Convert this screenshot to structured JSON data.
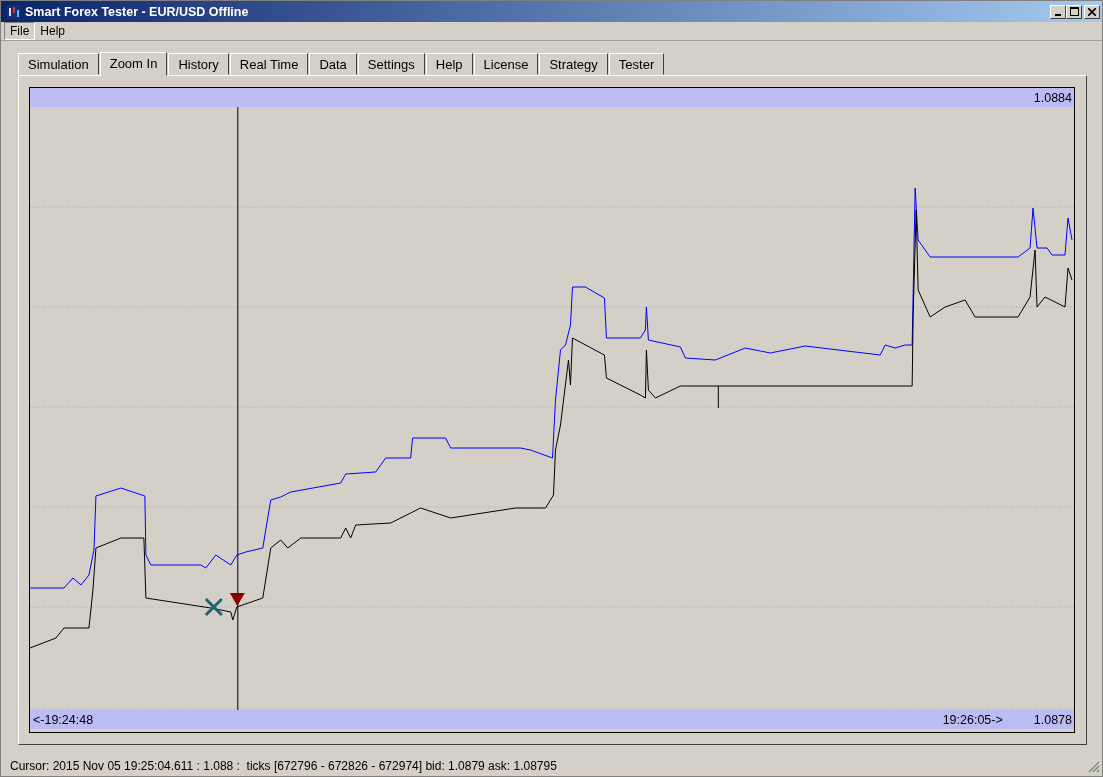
{
  "window": {
    "title": "Smart Forex Tester - EUR/USD Offline"
  },
  "menu": [
    "File",
    "Help"
  ],
  "tabs": [
    {
      "label": "Simulation",
      "selected": false
    },
    {
      "label": "Zoom In",
      "selected": true
    },
    {
      "label": "History",
      "selected": false
    },
    {
      "label": "Real Time",
      "selected": false
    },
    {
      "label": "Data",
      "selected": false
    },
    {
      "label": "Settings",
      "selected": false
    },
    {
      "label": "Help",
      "selected": false
    },
    {
      "label": "License",
      "selected": false
    },
    {
      "label": "Strategy",
      "selected": false
    },
    {
      "label": "Tester",
      "selected": false
    }
  ],
  "chart": {
    "top_price": "1.0884",
    "start_time": "<-19:24:48",
    "end_time": "19:26:05->",
    "bottom_price": "1.0878"
  },
  "status_bar": "Cursor: 2015 Nov 05 19:25:04.611 : 1.088 :  ticks [672796 - 672826 - 672974] bid: 1.0879 ask: 1.08795"
}
